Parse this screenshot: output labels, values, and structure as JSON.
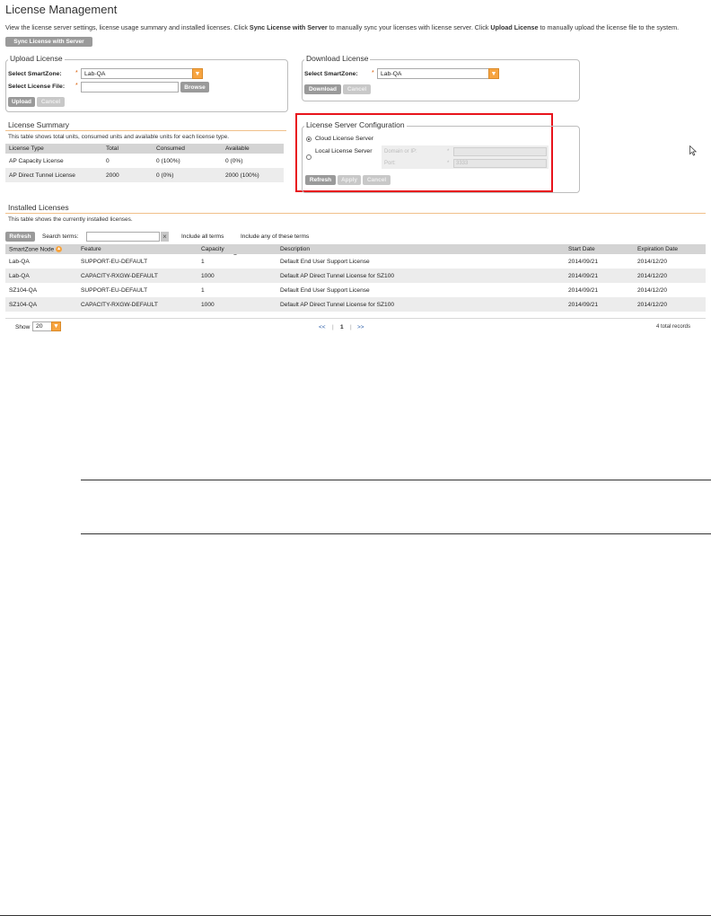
{
  "page": {
    "title": "License Management",
    "description": {
      "p1": "View the license server settings, license usage summary and installed licenses. Click ",
      "b1": "Sync License with Server",
      "p2": " to manually sync your licenses with license server. Click ",
      "b2": "Upload License",
      "p3": " to manually upload the license file to the system."
    },
    "sync_button": "Sync License with Server"
  },
  "upload": {
    "legend": "Upload License",
    "smartzone_label": "Select SmartZone:",
    "smartzone_value": "Lab-QA",
    "file_label": "Select License File:",
    "browse": "Browse",
    "upload": "Upload",
    "cancel": "Cancel",
    "required": "*"
  },
  "download": {
    "legend": "Download License",
    "smartzone_label": "Select SmartZone:",
    "smartzone_value": "Lab-QA",
    "download": "Download",
    "cancel": "Cancel",
    "required": "*"
  },
  "summary": {
    "title": "License Summary",
    "note": "This table shows total units, consumed units and available units for each license type.",
    "columns": [
      "License Type",
      "Total",
      "Consumed",
      "Available"
    ],
    "rows": [
      [
        "AP Capacity License",
        "0",
        "0 (100%)",
        "0 (0%)"
      ],
      [
        "AP Direct Tunnel License",
        "2000",
        "0 (0%)",
        "2000 (100%)"
      ]
    ]
  },
  "server_config": {
    "legend": "License Server Configuration",
    "cloud": "Cloud License Server",
    "local": "Local License Server",
    "domain_label": "Domain or IP:",
    "port_label": "Port:",
    "port_value": "3333",
    "required": "*",
    "refresh": "Refresh",
    "apply": "Apply",
    "cancel": "Cancel",
    "highlight_color": "#e8141c"
  },
  "installed": {
    "title": "Installed Licenses",
    "note": "This table shows the currently installed licenses.",
    "refresh": "Refresh",
    "search_label": "Search terms:",
    "clear": "×",
    "include_all": "Include all terms",
    "include_any": "Include any of these terms",
    "columns": [
      "SmartZone Node",
      "Feature",
      "Capacity",
      "Description",
      "Start Date",
      "Expiration Date"
    ],
    "rows": [
      [
        "Lab-QA",
        "SUPPORT-EU-DEFAULT",
        "1",
        "Default End User Support License",
        "2014/09/21",
        "2014/12/20"
      ],
      [
        "Lab-QA",
        "CAPACITY-RXGW-DEFAULT",
        "1000",
        "Default AP Direct Tunnel License for SZ100",
        "2014/09/21",
        "2014/12/20"
      ],
      [
        "SZ104-QA",
        "SUPPORT-EU-DEFAULT",
        "1",
        "Default End User Support License",
        "2014/09/21",
        "2014/12/20"
      ],
      [
        "SZ104-QA",
        "CAPACITY-RXGW-DEFAULT",
        "1000",
        "Default AP Direct Tunnel License for SZ100",
        "2014/09/21",
        "2014/12/20"
      ]
    ],
    "show_label": "Show",
    "page_size": "20",
    "pager_prev": "<<",
    "pager_sep": "|",
    "pager_page": "1",
    "pager_next": ">>",
    "total": "4 total records"
  },
  "colors": {
    "accent_orange": "#f7a440",
    "button_gray": "#9a9a9a",
    "highlight_red": "#e8141c"
  }
}
